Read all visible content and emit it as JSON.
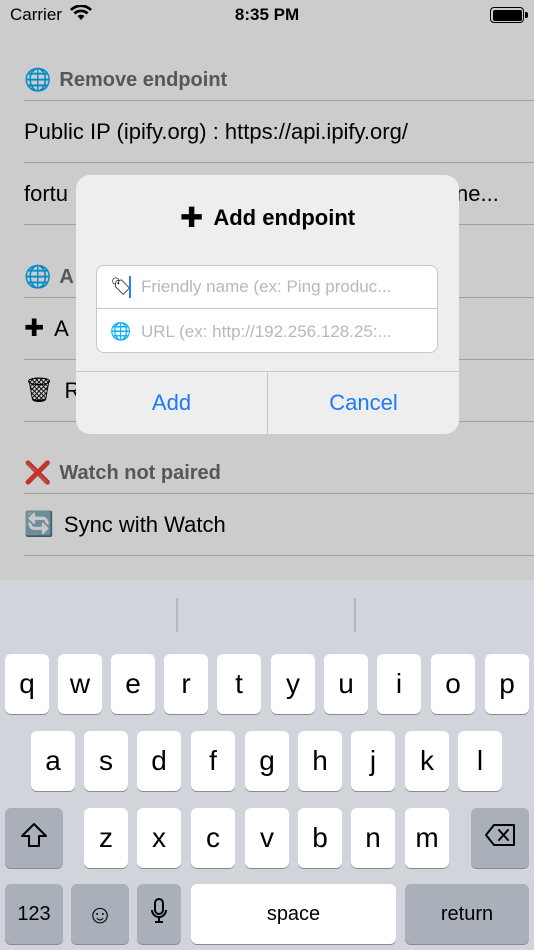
{
  "status_bar": {
    "carrier": "Carrier",
    "time": "8:35 PM"
  },
  "list": {
    "remove_header": "Remove endpoint",
    "rows": [
      "Public IP (ipify.org) : https://api.ipify.org/",
      "fortu",
      "ne..."
    ],
    "add_header": "A",
    "add_row": "A",
    "remove_row": "R",
    "watch_header": "Watch not paired",
    "sync_row": "Sync with Watch"
  },
  "alert": {
    "title": "Add endpoint",
    "name_placeholder": "Friendly name (ex: Ping produc...",
    "url_placeholder": "URL (ex: http://192.256.128.25:...",
    "add_label": "Add",
    "cancel_label": "Cancel"
  },
  "keyboard": {
    "row1": [
      "q",
      "w",
      "e",
      "r",
      "t",
      "y",
      "u",
      "i",
      "o",
      "p"
    ],
    "row2": [
      "a",
      "s",
      "d",
      "f",
      "g",
      "h",
      "j",
      "k",
      "l"
    ],
    "row3": [
      "z",
      "x",
      "c",
      "v",
      "b",
      "n",
      "m"
    ],
    "numbers_label": "123",
    "space_label": "space",
    "return_label": "return"
  },
  "icons": {
    "globe": "🌐",
    "plus": "✚",
    "trash": "🗑",
    "cross": "❌",
    "sync": "🔄",
    "tag": "🏷"
  },
  "colors": {
    "accent": "#1a7cf5",
    "keyboard_bg": "#d1d4da"
  }
}
